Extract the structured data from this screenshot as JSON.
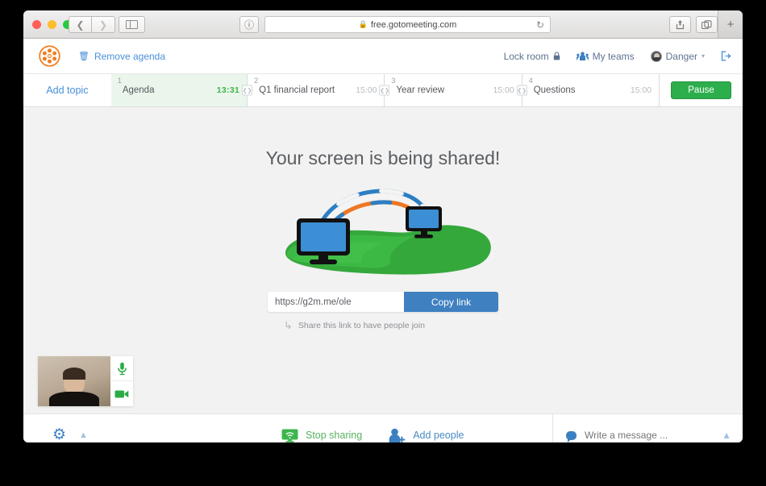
{
  "browser": {
    "url": "free.gotomeeting.com",
    "lock_icon": "lock-icon",
    "reload_icon": "reload-icon",
    "back_icon": "chevron-left-icon",
    "forward_icon": "chevron-right-icon",
    "sidebar_icon": "sidebar-toggle-icon",
    "shield_icon": "info-icon",
    "share_icon": "share-icon",
    "tabs_icon": "show-tabs-icon",
    "new_tab_label": "+"
  },
  "header": {
    "logo_name": "gotomeeting-logo",
    "remove_agenda_label": "Remove agenda",
    "trash_icon": "trash-icon",
    "lock_room_label": "Lock room",
    "lock_room_icon": "padlock-icon",
    "my_teams_label": "My teams",
    "my_teams_icon": "people-icon",
    "user_name": "Danger",
    "user_caret": "⌄",
    "logout_icon": "logout-icon"
  },
  "agenda": {
    "add_topic_label": "Add topic",
    "pause_label": "Pause",
    "topics": [
      {
        "num": "1",
        "name": "Agenda",
        "time": "13:31",
        "active": true
      },
      {
        "num": "2",
        "name": "Q1 financial report",
        "time": "15:00",
        "active": false
      },
      {
        "num": "3",
        "name": "Year review",
        "time": "15:00",
        "active": false
      },
      {
        "num": "4",
        "name": "Questions",
        "time": "15:00",
        "active": false
      }
    ]
  },
  "stage": {
    "title": "Your screen is being shared!",
    "illustration": "screen-sharing-illustration",
    "share_link_value": "https://g2m.me/ole",
    "share_link_placeholder": "https://g2m.me/ole",
    "copy_link_label": "Copy link",
    "hint": "Share this link to have people join",
    "hint_icon": "curved-arrow-icon"
  },
  "webcam": {
    "name": "self-video-preview",
    "mic_icon": "microphone-icon",
    "camera_icon": "camera-icon"
  },
  "toolbar": {
    "gear_icon": "gear-icon",
    "chevron_up_icon": "chevron-up-icon",
    "stop_sharing_label": "Stop sharing",
    "stop_sharing_icon": "screen-share-icon",
    "add_people_label": "Add people",
    "add_people_icon": "add-person-icon",
    "chat_placeholder": "Write a message ...",
    "chat_icon": "chat-bubble-icon",
    "chat_expand_icon": "chevron-up-icon"
  },
  "colors": {
    "green": "#2cae4c",
    "blue": "#3e80c0",
    "link_blue": "#4a90d9",
    "active_topic": "#eaf6ec",
    "stage_bg": "#f2f2f2"
  }
}
